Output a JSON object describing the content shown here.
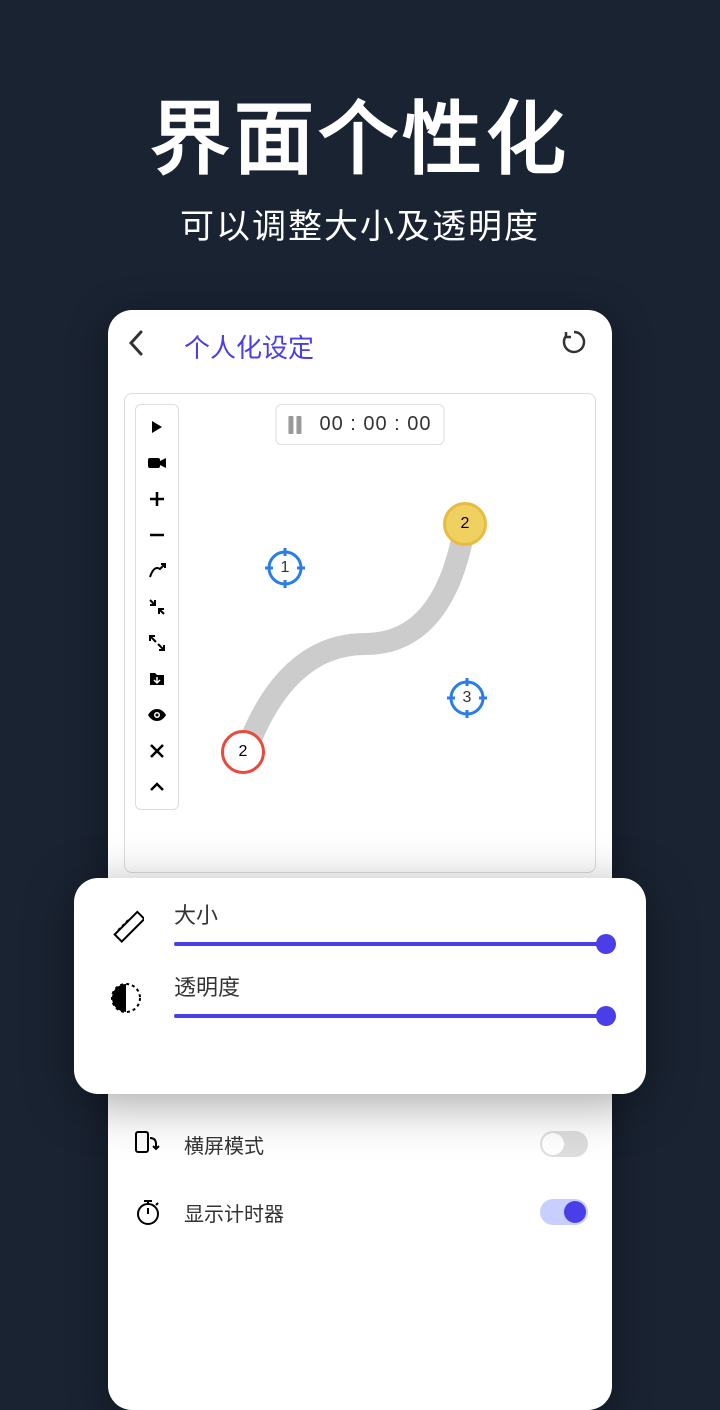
{
  "hero": {
    "title": "界面个性化",
    "subtitle": "可以调整大小及透明度"
  },
  "header": {
    "title": "个人化设定"
  },
  "timer": {
    "value": "00 : 00 : 00"
  },
  "targets": {
    "t1": "1",
    "t2": "2",
    "t3": "3"
  },
  "nodes": {
    "start": "2",
    "end": "2"
  },
  "sliders": {
    "size_label": "大小",
    "opacity_label": "透明度"
  },
  "settings": {
    "landscape_label": "横屏模式",
    "timer_label": "显示计时器"
  }
}
